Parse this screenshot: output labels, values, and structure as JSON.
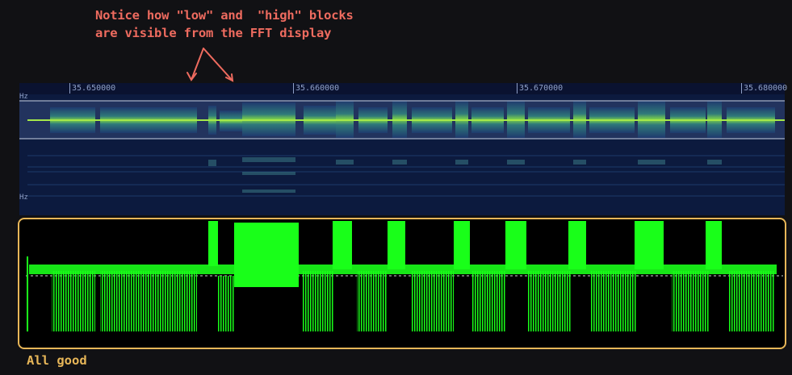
{
  "annotation": {
    "line1": "Notice how \"low\" and  \"high\" blocks",
    "line2": "are visible from the FFT display"
  },
  "waterfall": {
    "freq_labels": [
      "35.650000",
      "35.660000",
      "35.670000",
      "35.680000"
    ],
    "hz_label_top": "Hz",
    "hz_label_bottom": "Hz"
  },
  "caption": "All good",
  "colors": {
    "annotation": "#ee6b5f",
    "highlight_box": "#e7b658",
    "signal": "#19ff19",
    "waterfall_bg": "#0c1a3e"
  }
}
